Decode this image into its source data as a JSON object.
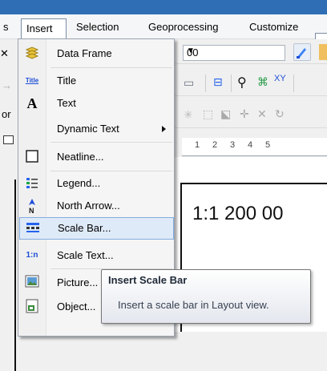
{
  "menubar": {
    "items": [
      {
        "label": "s"
      },
      {
        "label": "Insert"
      },
      {
        "label": "Selection"
      },
      {
        "label": "Geoprocessing"
      },
      {
        "label": "Customize"
      }
    ]
  },
  "toolbar": {
    "combo_value": "00",
    "ruler_labels": [
      "1",
      "2",
      "3",
      "4",
      "5"
    ]
  },
  "left_sliver": {
    "texts": [
      "or"
    ]
  },
  "layout": {
    "scale_text": "1:1 200 00"
  },
  "dropdown": {
    "items": [
      {
        "label": "Data Frame",
        "icon": "data-frame-icon"
      },
      {
        "label": "Title",
        "icon": "title-icon"
      },
      {
        "label": "Text",
        "icon": "text-icon"
      },
      {
        "label": "Dynamic Text",
        "icon": ""
      },
      {
        "label": "Neatline...",
        "icon": "neatline-icon"
      },
      {
        "label": "Legend...",
        "icon": "legend-icon"
      },
      {
        "label": "North Arrow...",
        "icon": "north-arrow-icon"
      },
      {
        "label": "Scale Bar...",
        "icon": "scale-bar-icon"
      },
      {
        "label": "Scale Text...",
        "icon": "scale-text-icon"
      },
      {
        "label": "Picture...",
        "icon": "picture-icon"
      },
      {
        "label": "Object...",
        "icon": "object-icon"
      }
    ],
    "icon_glyphs": {
      "title": "Title",
      "text": "A",
      "north": "N",
      "scale_text": "1:n"
    }
  },
  "tooltip": {
    "title": "Insert Scale Bar",
    "body": "Insert a scale bar in Layout view."
  },
  "colors": {
    "highlight": "#dfeaf8",
    "highlight_border": "#84acdd",
    "titlebar": "#2f6db5"
  }
}
